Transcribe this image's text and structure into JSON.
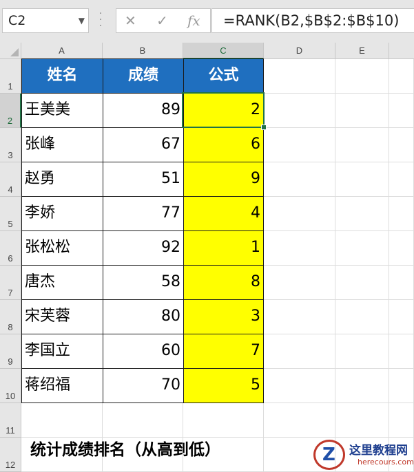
{
  "formula_bar": {
    "name_box": "C2",
    "cancel_glyph": "✕",
    "enter_glyph": "✓",
    "fx_glyph": "fx",
    "formula": "=RANK(B2,$B$2:$B$10)"
  },
  "columns": [
    "A",
    "B",
    "C",
    "D",
    "E"
  ],
  "rows": [
    "1",
    "2",
    "3",
    "4",
    "5",
    "6",
    "7",
    "8",
    "9",
    "10",
    "11",
    "12"
  ],
  "selected_cell": "C2",
  "table": {
    "headers": [
      "姓名",
      "成绩",
      "公式"
    ],
    "data": [
      {
        "name": "王美美",
        "score": "89",
        "rank": "2"
      },
      {
        "name": "张峰",
        "score": "67",
        "rank": "6"
      },
      {
        "name": "赵勇",
        "score": "51",
        "rank": "9"
      },
      {
        "name": "李娇",
        "score": "77",
        "rank": "4"
      },
      {
        "name": "张松松",
        "score": "92",
        "rank": "1"
      },
      {
        "name": "唐杰",
        "score": "58",
        "rank": "8"
      },
      {
        "name": "宋芙蓉",
        "score": "80",
        "rank": "3"
      },
      {
        "name": "李国立",
        "score": "60",
        "rank": "7"
      },
      {
        "name": "蒋绍福",
        "score": "70",
        "rank": "5"
      }
    ]
  },
  "caption": "统计成绩排名（从高到低）",
  "watermark": {
    "title": "这里教程网",
    "url": "herecours.com"
  },
  "colors": {
    "header_blue": "#1f6fbf",
    "highlight_yellow": "#ffff00",
    "excel_green": "#217346"
  }
}
